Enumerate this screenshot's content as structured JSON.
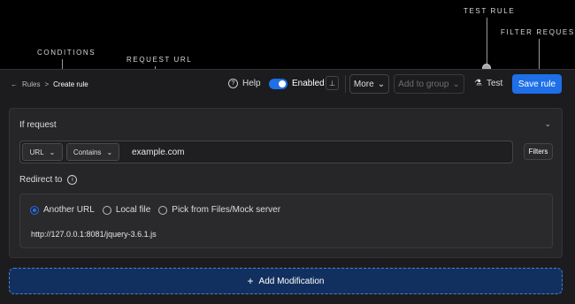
{
  "callouts": {
    "test_rule": "TEST RULE",
    "filter_requests": "FILTER REQUESTS",
    "conditions": "CONDITIONS",
    "request_url": "REQUEST URL"
  },
  "breadcrumb": {
    "root": "Rules",
    "separator": ">",
    "current": "Create rule"
  },
  "toolbar": {
    "help_label": "Help",
    "enabled_label": "Enabled",
    "enabled": true,
    "more_label": "More",
    "add_to_group_label": "Add to group",
    "test_label": "Test",
    "save_label": "Save rule"
  },
  "condition": {
    "heading": "If request",
    "field_select": "URL",
    "operator_select": "Contains",
    "url_value": "example.com",
    "filters_label": "Filters"
  },
  "redirect": {
    "heading": "Redirect to",
    "options": [
      "Another URL",
      "Local file",
      "Pick from Files/Mock server"
    ],
    "selected": "Another URL",
    "target_url": "http://127.0.0.1:8081/jquery-3.6.1.js"
  },
  "add_modification_label": "Add Modification",
  "colors": {
    "accent": "#1e6fe8",
    "background": "#1c1c1e",
    "card": "#262628"
  }
}
